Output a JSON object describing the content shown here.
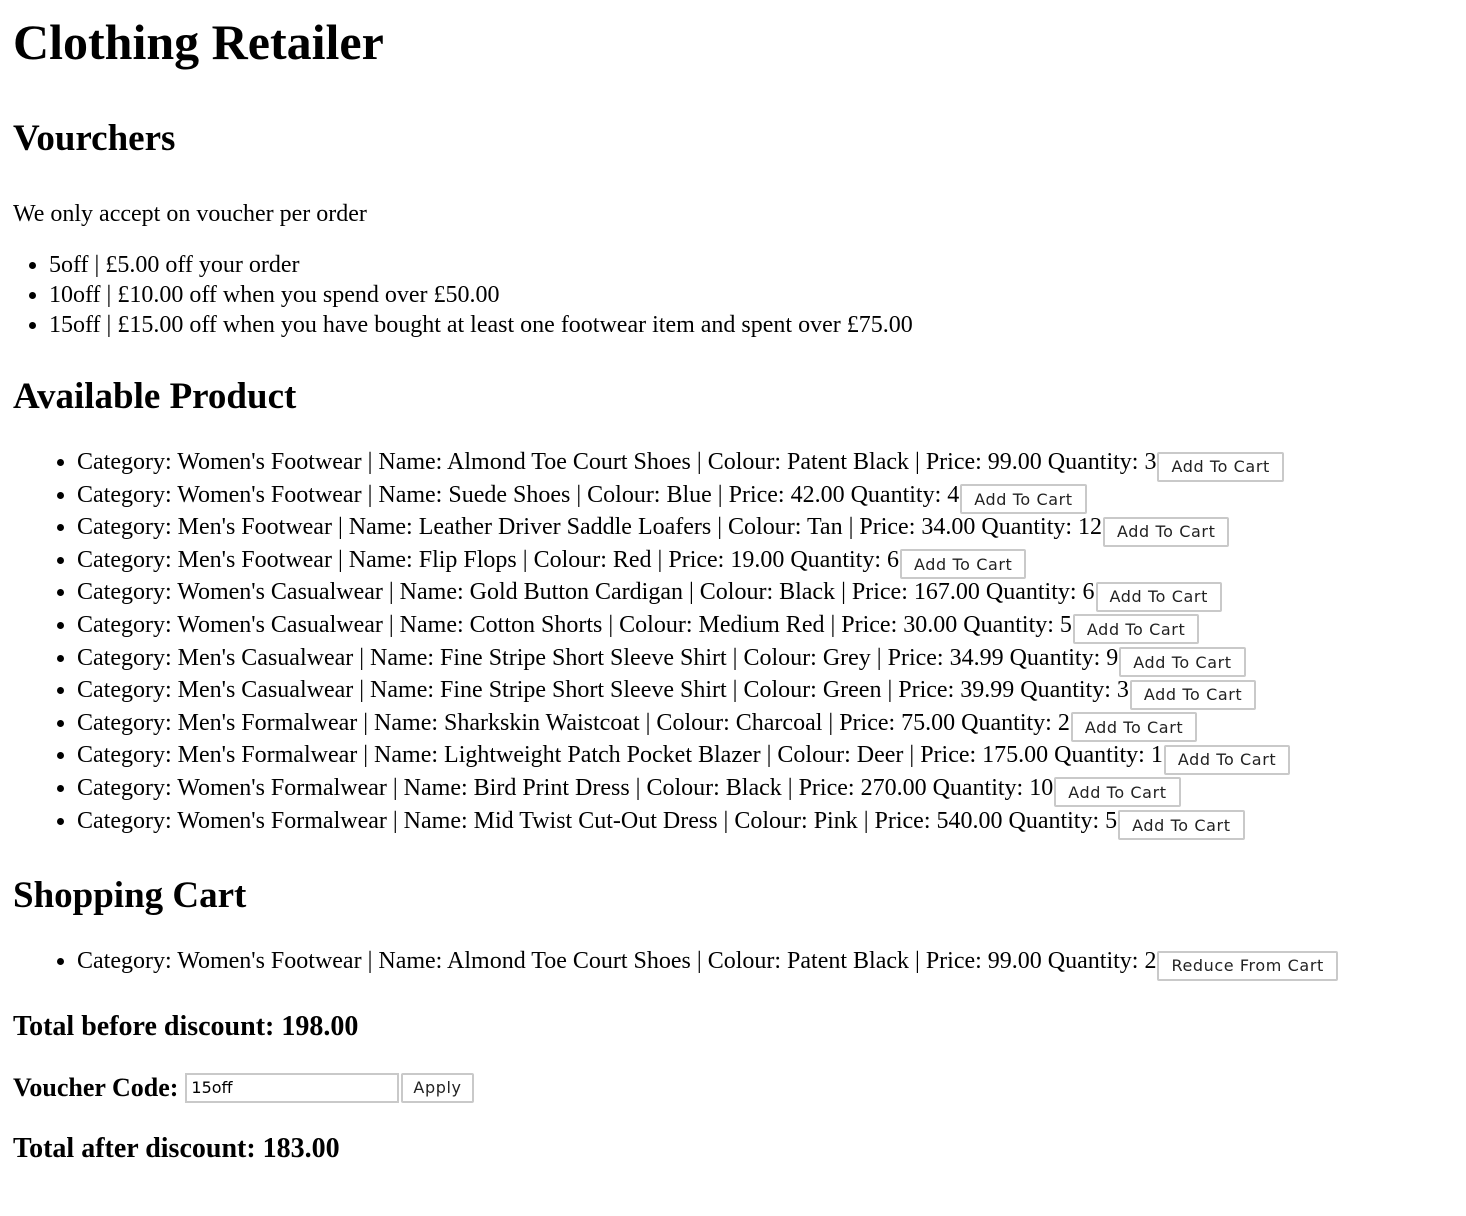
{
  "page": {
    "title": "Clothing Retailer"
  },
  "vouchers": {
    "heading": "Vourchers",
    "note": "We only accept on voucher per order",
    "items": [
      "5off | £5.00 off your order",
      "10off | £10.00 off when you spend over £50.00",
      "15off | £15.00 off when you have bought at least one footwear item and spent over £75.00"
    ]
  },
  "products": {
    "heading": "Available Product",
    "button_label": "Add To Cart",
    "items": [
      "Category: Women's Footwear | Name: Almond Toe Court Shoes | Colour: Patent Black | Price: 99.00 Quantity: 3",
      "Category: Women's Footwear | Name: Suede Shoes | Colour: Blue | Price: 42.00 Quantity: 4",
      "Category: Men's Footwear | Name: Leather Driver Saddle Loafers | Colour: Tan | Price: 34.00 Quantity: 12",
      "Category: Men's Footwear | Name: Flip Flops | Colour: Red | Price: 19.00 Quantity: 6",
      "Category: Women's Casualwear | Name: Gold Button Cardigan | Colour: Black | Price: 167.00 Quantity: 6",
      "Category: Women's Casualwear | Name: Cotton Shorts | Colour: Medium Red | Price: 30.00 Quantity: 5",
      "Category: Men's Casualwear | Name: Fine Stripe Short Sleeve Shirt | Colour: Grey | Price: 34.99 Quantity: 9",
      "Category: Men's Casualwear | Name: Fine Stripe Short Sleeve Shirt | Colour: Green | Price: 39.99 Quantity: 3",
      "Category: Men's Formalwear | Name: Sharkskin Waistcoat | Colour: Charcoal | Price: 75.00 Quantity: 2",
      "Category: Men's Formalwear | Name: Lightweight Patch Pocket Blazer | Colour: Deer | Price: 175.00 Quantity: 1",
      "Category: Women's Formalwear | Name: Bird Print Dress | Colour: Black | Price: 270.00 Quantity: 10",
      "Category: Women's Formalwear | Name: Mid Twist Cut-Out Dress | Colour: Pink | Price: 540.00 Quantity: 5"
    ]
  },
  "cart": {
    "heading": "Shopping Cart",
    "button_label": "Reduce From Cart",
    "items": [
      "Category: Women's Footwear | Name: Almond Toe Court Shoes | Colour: Patent Black | Price: 99.00 Quantity: 2"
    ],
    "total_before": "Total before discount: 198.00",
    "voucher_label": "Voucher Code:",
    "voucher_value": "15off",
    "apply_label": "Apply",
    "total_after": "Total after discount: 183.00"
  }
}
